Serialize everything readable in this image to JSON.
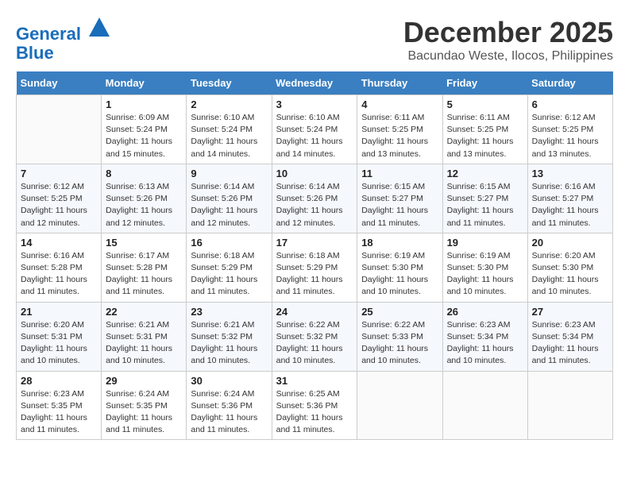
{
  "header": {
    "logo_line1": "General",
    "logo_line2": "Blue",
    "month": "December 2025",
    "location": "Bacundao Weste, Ilocos, Philippines"
  },
  "days_of_week": [
    "Sunday",
    "Monday",
    "Tuesday",
    "Wednesday",
    "Thursday",
    "Friday",
    "Saturday"
  ],
  "weeks": [
    [
      {
        "day": "",
        "info": ""
      },
      {
        "day": "1",
        "info": "Sunrise: 6:09 AM\nSunset: 5:24 PM\nDaylight: 11 hours\nand 15 minutes."
      },
      {
        "day": "2",
        "info": "Sunrise: 6:10 AM\nSunset: 5:24 PM\nDaylight: 11 hours\nand 14 minutes."
      },
      {
        "day": "3",
        "info": "Sunrise: 6:10 AM\nSunset: 5:24 PM\nDaylight: 11 hours\nand 14 minutes."
      },
      {
        "day": "4",
        "info": "Sunrise: 6:11 AM\nSunset: 5:25 PM\nDaylight: 11 hours\nand 13 minutes."
      },
      {
        "day": "5",
        "info": "Sunrise: 6:11 AM\nSunset: 5:25 PM\nDaylight: 11 hours\nand 13 minutes."
      },
      {
        "day": "6",
        "info": "Sunrise: 6:12 AM\nSunset: 5:25 PM\nDaylight: 11 hours\nand 13 minutes."
      }
    ],
    [
      {
        "day": "7",
        "info": "Sunrise: 6:12 AM\nSunset: 5:25 PM\nDaylight: 11 hours\nand 12 minutes."
      },
      {
        "day": "8",
        "info": "Sunrise: 6:13 AM\nSunset: 5:26 PM\nDaylight: 11 hours\nand 12 minutes."
      },
      {
        "day": "9",
        "info": "Sunrise: 6:14 AM\nSunset: 5:26 PM\nDaylight: 11 hours\nand 12 minutes."
      },
      {
        "day": "10",
        "info": "Sunrise: 6:14 AM\nSunset: 5:26 PM\nDaylight: 11 hours\nand 12 minutes."
      },
      {
        "day": "11",
        "info": "Sunrise: 6:15 AM\nSunset: 5:27 PM\nDaylight: 11 hours\nand 11 minutes."
      },
      {
        "day": "12",
        "info": "Sunrise: 6:15 AM\nSunset: 5:27 PM\nDaylight: 11 hours\nand 11 minutes."
      },
      {
        "day": "13",
        "info": "Sunrise: 6:16 AM\nSunset: 5:27 PM\nDaylight: 11 hours\nand 11 minutes."
      }
    ],
    [
      {
        "day": "14",
        "info": "Sunrise: 6:16 AM\nSunset: 5:28 PM\nDaylight: 11 hours\nand 11 minutes."
      },
      {
        "day": "15",
        "info": "Sunrise: 6:17 AM\nSunset: 5:28 PM\nDaylight: 11 hours\nand 11 minutes."
      },
      {
        "day": "16",
        "info": "Sunrise: 6:18 AM\nSunset: 5:29 PM\nDaylight: 11 hours\nand 11 minutes."
      },
      {
        "day": "17",
        "info": "Sunrise: 6:18 AM\nSunset: 5:29 PM\nDaylight: 11 hours\nand 11 minutes."
      },
      {
        "day": "18",
        "info": "Sunrise: 6:19 AM\nSunset: 5:30 PM\nDaylight: 11 hours\nand 10 minutes."
      },
      {
        "day": "19",
        "info": "Sunrise: 6:19 AM\nSunset: 5:30 PM\nDaylight: 11 hours\nand 10 minutes."
      },
      {
        "day": "20",
        "info": "Sunrise: 6:20 AM\nSunset: 5:30 PM\nDaylight: 11 hours\nand 10 minutes."
      }
    ],
    [
      {
        "day": "21",
        "info": "Sunrise: 6:20 AM\nSunset: 5:31 PM\nDaylight: 11 hours\nand 10 minutes."
      },
      {
        "day": "22",
        "info": "Sunrise: 6:21 AM\nSunset: 5:31 PM\nDaylight: 11 hours\nand 10 minutes."
      },
      {
        "day": "23",
        "info": "Sunrise: 6:21 AM\nSunset: 5:32 PM\nDaylight: 11 hours\nand 10 minutes."
      },
      {
        "day": "24",
        "info": "Sunrise: 6:22 AM\nSunset: 5:32 PM\nDaylight: 11 hours\nand 10 minutes."
      },
      {
        "day": "25",
        "info": "Sunrise: 6:22 AM\nSunset: 5:33 PM\nDaylight: 11 hours\nand 10 minutes."
      },
      {
        "day": "26",
        "info": "Sunrise: 6:23 AM\nSunset: 5:34 PM\nDaylight: 11 hours\nand 10 minutes."
      },
      {
        "day": "27",
        "info": "Sunrise: 6:23 AM\nSunset: 5:34 PM\nDaylight: 11 hours\nand 11 minutes."
      }
    ],
    [
      {
        "day": "28",
        "info": "Sunrise: 6:23 AM\nSunset: 5:35 PM\nDaylight: 11 hours\nand 11 minutes."
      },
      {
        "day": "29",
        "info": "Sunrise: 6:24 AM\nSunset: 5:35 PM\nDaylight: 11 hours\nand 11 minutes."
      },
      {
        "day": "30",
        "info": "Sunrise: 6:24 AM\nSunset: 5:36 PM\nDaylight: 11 hours\nand 11 minutes."
      },
      {
        "day": "31",
        "info": "Sunrise: 6:25 AM\nSunset: 5:36 PM\nDaylight: 11 hours\nand 11 minutes."
      },
      {
        "day": "",
        "info": ""
      },
      {
        "day": "",
        "info": ""
      },
      {
        "day": "",
        "info": ""
      }
    ]
  ]
}
